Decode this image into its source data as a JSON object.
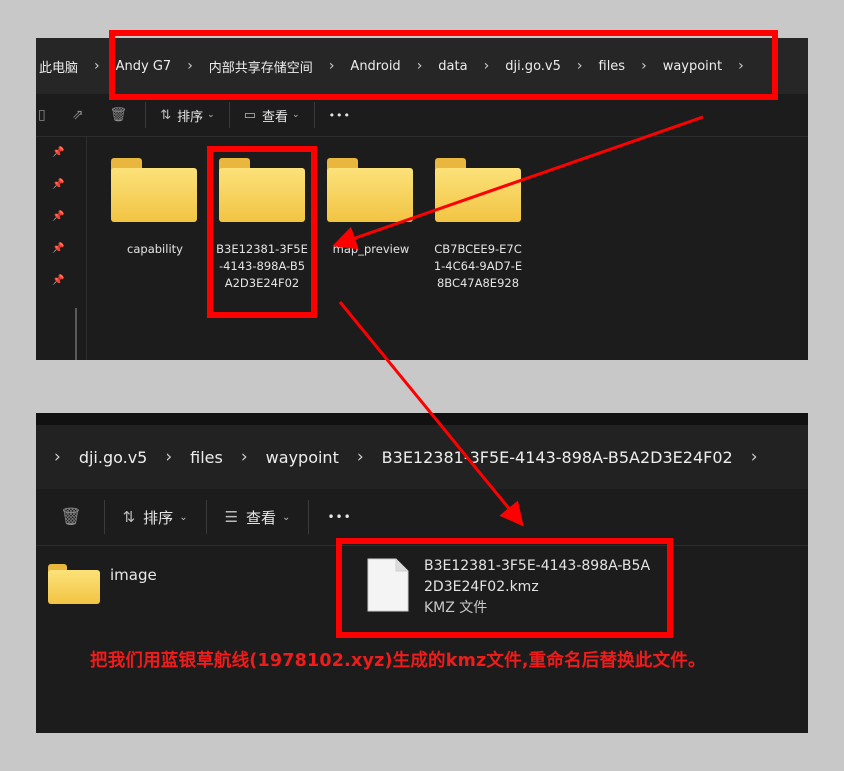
{
  "top_window": {
    "breadcrumb": [
      "此电脑",
      "Andy G7",
      "内部共享存储空间",
      "Android",
      "data",
      "dji.go.v5",
      "files",
      "waypoint"
    ],
    "toolbar": {
      "sort_label": "排序",
      "view_label": "查看",
      "more_label": "•••"
    },
    "folders": [
      {
        "name": "capability"
      },
      {
        "name": "B3E12381-3F5E-4143-898A-B5A2D3E24F02",
        "lines": [
          "B3E12381-3F5E",
          "-4143-898A-B5",
          "A2D3E24F02"
        ]
      },
      {
        "name": "map_preview"
      },
      {
        "name": "CB7BCEE9-E7C1-4C64-9AD7-E8BC47A8E928",
        "lines": [
          "CB7BCEE9-E7C",
          "1-4C64-9AD7-E",
          "8BC47A8E928"
        ]
      }
    ]
  },
  "bottom_window": {
    "breadcrumb": [
      "dji.go.v5",
      "files",
      "waypoint",
      "B3E12381-3F5E-4143-898A-B5A2D3E24F02"
    ],
    "toolbar": {
      "sort_label": "排序",
      "view_label": "查看",
      "more_label": "•••"
    },
    "folder": {
      "name": "image"
    },
    "file": {
      "name_line1": "B3E12381-3F5E-4143-898A-B5A",
      "name_line2": "2D3E24F02.kmz",
      "type": "KMZ 文件"
    }
  },
  "annotation": {
    "caption": "把我们用蓝银草航线(1978102.xyz)生成的kmz文件,重命名后替换此文件。",
    "color": "#ff0000"
  }
}
